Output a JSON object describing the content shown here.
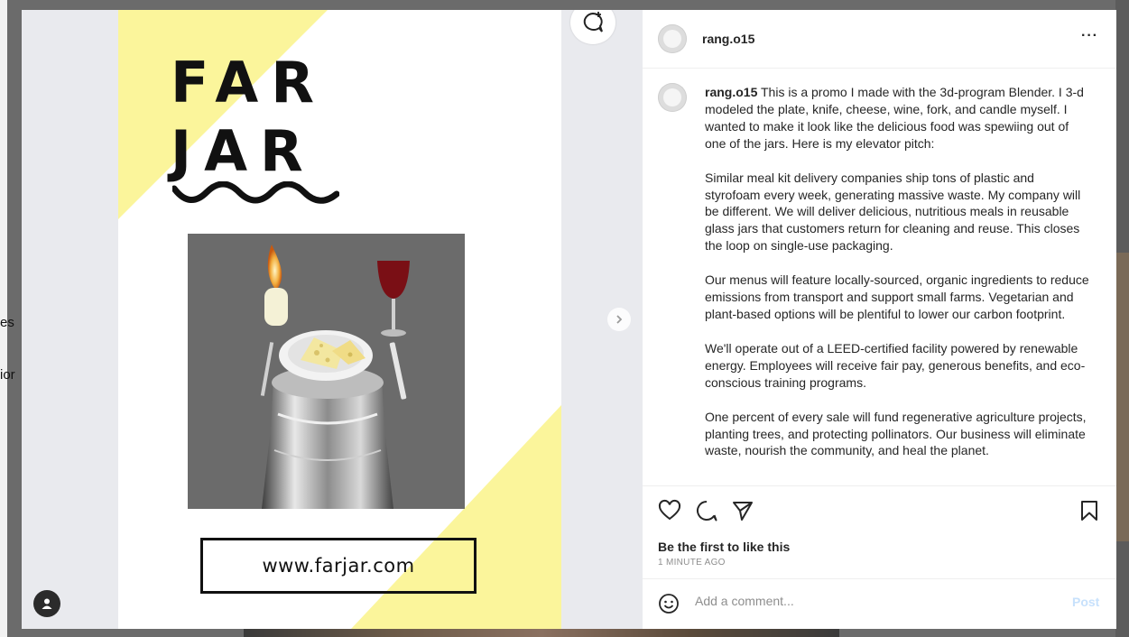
{
  "background": {
    "fragments": [
      "es",
      "ior"
    ]
  },
  "post": {
    "username": "rang.o15",
    "more_label": "···",
    "poster": {
      "brand_line1": "FAR",
      "brand_line2": "JAR",
      "url": "www.farjar.com",
      "accent_color": "#fbf59b"
    },
    "caption": {
      "username": "rang.o15",
      "paragraphs": [
        "This is a promo I made with the 3d-program Blender. I 3-d modeled the plate, knife, cheese, wine, fork, and candle myself. I wanted to make it look like the delicious food was spewiing out of one of the jars. Here is my elevator pitch:",
        "Similar meal kit delivery companies ship tons of plastic and styrofoam every week, generating massive waste. My company will be different. We will deliver delicious, nutritious meals in reusable glass jars that customers return for cleaning and reuse. This closes the loop on single-use packaging.",
        "Our menus will feature locally-sourced, organic ingredients to reduce emissions from transport and support small farms. Vegetarian and plant-based options will be plentiful to lower our carbon footprint.",
        "We'll operate out of a LEED-certified facility powered by renewable energy. Employees will receive fair pay, generous benefits, and eco-conscious training programs.",
        "One percent of every sale will fund regenerative agriculture projects, planting trees, and protecting pollinators. Our business will eliminate waste, nourish the community, and heal the planet."
      ]
    },
    "likes_text": "Be the first to like this",
    "time_ago": "1 MINUTE AGO",
    "comment": {
      "placeholder": "Add a comment...",
      "post_label": "Post"
    },
    "icons": {
      "like": "heart-icon",
      "comment": "comment-icon",
      "share": "send-icon",
      "save": "bookmark-icon",
      "emoji": "emoji-icon",
      "next": "chevron-right-icon",
      "account": "account-icon",
      "comment_bubble": "add-comment-icon"
    },
    "colors": {
      "post_button": "#c7e1fc",
      "secondary_text": "#8e8e8e"
    }
  }
}
